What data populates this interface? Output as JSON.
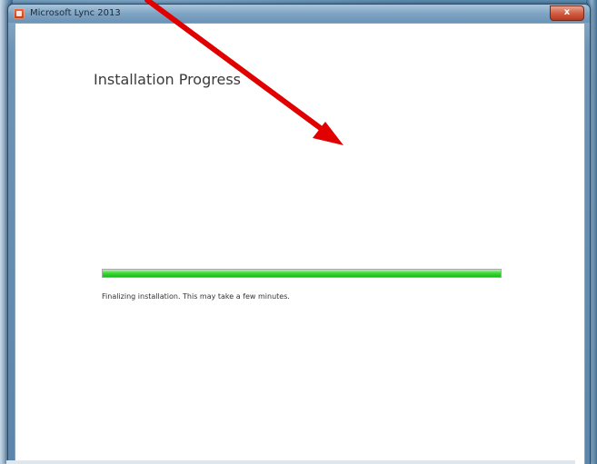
{
  "window": {
    "title": "Microsoft Lync 2013",
    "close_glyph": "x"
  },
  "main": {
    "heading": "Installation Progress",
    "progress_percent": 100,
    "status": "Finalizing installation. This may take a few minutes."
  },
  "colors": {
    "progress_fill": "#2ecc2a",
    "annotation_arrow": "#e00000"
  },
  "icons": {
    "app_icon": "office-logo-icon",
    "annotation": "red-arrow-icon"
  }
}
